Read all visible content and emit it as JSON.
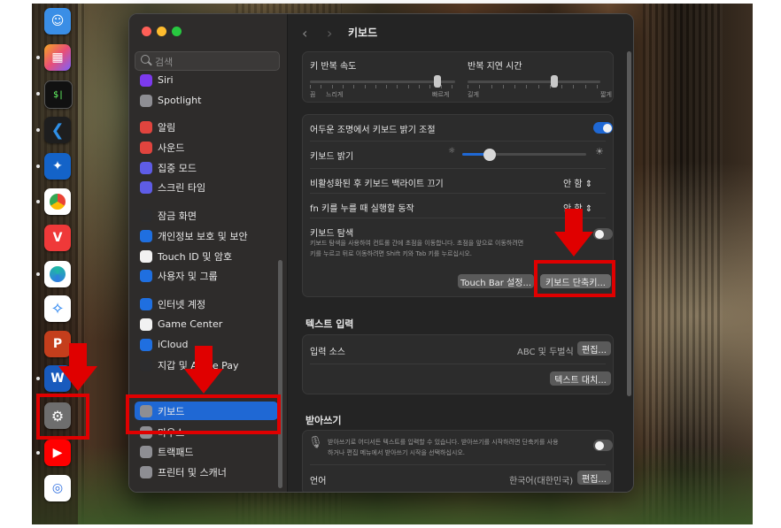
{
  "sidebar": {
    "search_placeholder": "검색",
    "items": [
      {
        "label": "Siri",
        "icon": "siri-icon",
        "color": "#7c3aed"
      },
      {
        "label": "Spotlight",
        "icon": "spotlight-icon",
        "color": "#8e8e93"
      },
      {
        "label": "알림",
        "icon": "bell-icon",
        "color": "#e0443e"
      },
      {
        "label": "사운드",
        "icon": "speaker-icon",
        "color": "#e0443e"
      },
      {
        "label": "집중 모드",
        "icon": "moon-icon",
        "color": "#5e5ce6"
      },
      {
        "label": "스크린 타임",
        "icon": "hourglass-icon",
        "color": "#5e5ce6"
      },
      {
        "label": "잠금 화면",
        "icon": "lock-icon",
        "color": "#2c2c2e"
      },
      {
        "label": "개인정보 보호 및 보안",
        "icon": "hand-icon",
        "color": "#1f6fe0"
      },
      {
        "label": "Touch ID 및 암호",
        "icon": "fingerprint-icon",
        "color": "#f2f2f2"
      },
      {
        "label": "사용자 및 그룹",
        "icon": "users-icon",
        "color": "#1f6fe0"
      },
      {
        "label": "인터넷 계정",
        "icon": "at-icon",
        "color": "#1f6fe0"
      },
      {
        "label": "Game Center",
        "icon": "game-center-icon",
        "color": "#f2f2f2"
      },
      {
        "label": "iCloud",
        "icon": "cloud-icon",
        "color": "#1f6fe0"
      },
      {
        "label": "지갑 및 Apple Pay",
        "icon": "wallet-icon",
        "color": "#2c2c2e"
      },
      {
        "label": "키보드",
        "icon": "keyboard-icon",
        "color": "#8e8e93"
      },
      {
        "label": "마우스",
        "icon": "mouse-icon",
        "color": "#8e8e93"
      },
      {
        "label": "트랙패드",
        "icon": "trackpad-icon",
        "color": "#8e8e93"
      },
      {
        "label": "프린터 및 스캐너",
        "icon": "printer-icon",
        "color": "#8e8e93"
      }
    ],
    "active_label": "키보드"
  },
  "content": {
    "title": "키보드",
    "repeat_rate_label": "키 반복 속도",
    "repeat_rate_min": "끔",
    "repeat_rate_slow": "느리게",
    "repeat_rate_fast": "빠르게",
    "delay_label": "반복 지연 시간",
    "delay_long": "길게",
    "delay_short": "짧게",
    "repeat_rate_level": 0.88,
    "delay_level": 0.6,
    "adjust_brightness_label": "어두운 조명에서 키보드 밝기 조절",
    "adjust_brightness_on": true,
    "brightness_label": "키보드 밝기",
    "brightness_level": 0.22,
    "backlight_off_label": "비활성화된 후 키보드 백라이트 끄기",
    "backlight_off_value": "안 함",
    "fn_label": "fn 키를 누를 때 실행할 동작",
    "fn_value": "안 함",
    "nav_label": "키보드 탐색",
    "nav_desc_1": "키보드 탐색을 사용하여 컨트롤 간에 초점을 이동합니다. 초점을 앞으로 이동하려면",
    "nav_desc_2": "키를 누르고 뒤로 이동하려면 Shift 키와 Tab 키를 누르십시오.",
    "nav_on": false,
    "touchbar_button": "Touch Bar 설정...",
    "shortcuts_button": "키보드 단축키...",
    "text_input_section": "텍스트 입력",
    "input_source_label": "입력 소스",
    "input_source_value": "ABC 및 두벌식",
    "edit_button": "편집...",
    "text_replace_button": "텍스트 대치...",
    "dictation_section": "받아쓰기",
    "dictation_desc_1": "받아쓰기로 어디서든 텍스트를 입력할 수 있습니다. 받아쓰기를 시작하려면 단축키를 사용",
    "dictation_desc_2": "하거나 편집 메뉴에서 받아쓰기 시작을 선택하십시오.",
    "dictation_on": false,
    "language_label": "언어",
    "language_value": "한국어(대한민국)",
    "language_edit_button": "편집..."
  },
  "colors": {
    "accent": "#1f68d4",
    "annotation_red": "#e00000"
  }
}
